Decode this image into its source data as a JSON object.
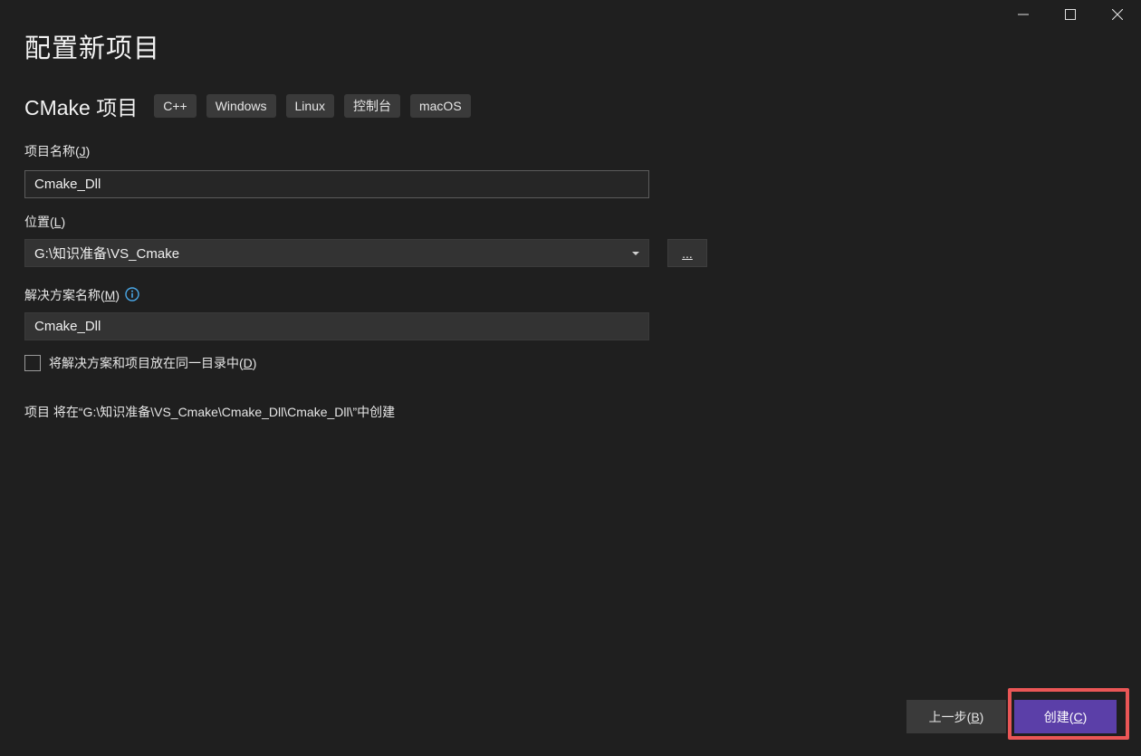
{
  "header": {
    "title": "配置新项目"
  },
  "window_controls": {
    "minimize_icon": "minimize-icon",
    "maximize_icon": "maximize-icon",
    "close_icon": "close-icon"
  },
  "template": {
    "name": "CMake 项目",
    "tags": [
      "C++",
      "Windows",
      "Linux",
      "控制台",
      "macOS"
    ]
  },
  "project_name": {
    "label_text": "项目名称(",
    "label_key": "J",
    "label_end": ")",
    "value": "Cmake_Dll"
  },
  "location": {
    "label_text": "位置(",
    "label_key": "L",
    "label_end": ")",
    "value": "G:\\知识准备\\VS_Cmake",
    "browse_label": "..."
  },
  "solution_name": {
    "label_text": "解决方案名称(",
    "label_key": "M",
    "label_end": ")",
    "value": "Cmake_Dll",
    "info_icon": "info-icon"
  },
  "same_directory": {
    "label_text": "将解决方案和项目放在同一目录中(",
    "label_key": "D",
    "label_end": ")",
    "checked": false
  },
  "path_note": "项目 将在“G:\\知识准备\\VS_Cmake\\Cmake_Dll\\Cmake_Dll\\”中创建",
  "footer": {
    "back_text": "上一步(",
    "back_key": "B",
    "back_end": ")",
    "create_text": "创建(",
    "create_key": "C",
    "create_end": ")"
  },
  "colors": {
    "background": "#1f1f1f",
    "accent": "#5b3fa8",
    "highlight": "#ea5656",
    "info": "#4aa8e8"
  }
}
